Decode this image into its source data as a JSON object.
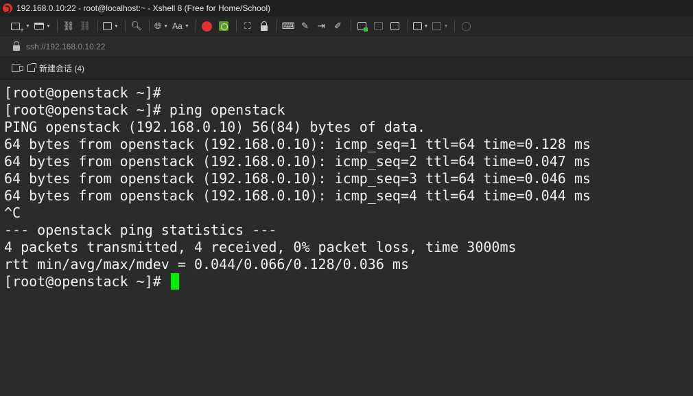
{
  "window": {
    "title": "192.168.0.10:22 - root@localhost:~ - Xshell 8 (Free for Home/School)"
  },
  "address": {
    "url": "ssh://192.168.0.10:22"
  },
  "tabbar": {
    "tabs": [
      {
        "label": "新建会话 (4)"
      }
    ]
  },
  "toolbar": {
    "font_label": "Aa"
  },
  "terminal": {
    "lines": [
      "[root@openstack ~]#",
      "[root@openstack ~]# ping openstack",
      "PING openstack (192.168.0.10) 56(84) bytes of data.",
      "64 bytes from openstack (192.168.0.10): icmp_seq=1 ttl=64 time=0.128 ms",
      "64 bytes from openstack (192.168.0.10): icmp_seq=2 ttl=64 time=0.047 ms",
      "64 bytes from openstack (192.168.0.10): icmp_seq=3 ttl=64 time=0.046 ms",
      "64 bytes from openstack (192.168.0.10): icmp_seq=4 ttl=64 time=0.044 ms",
      "^C",
      "--- openstack ping statistics ---",
      "4 packets transmitted, 4 received, 0% packet loss, time 3000ms",
      "rtt min/avg/max/mdev = 0.044/0.066/0.128/0.036 ms"
    ],
    "prompt": "[root@openstack ~]# ",
    "cursor_color": "#00ee00"
  }
}
